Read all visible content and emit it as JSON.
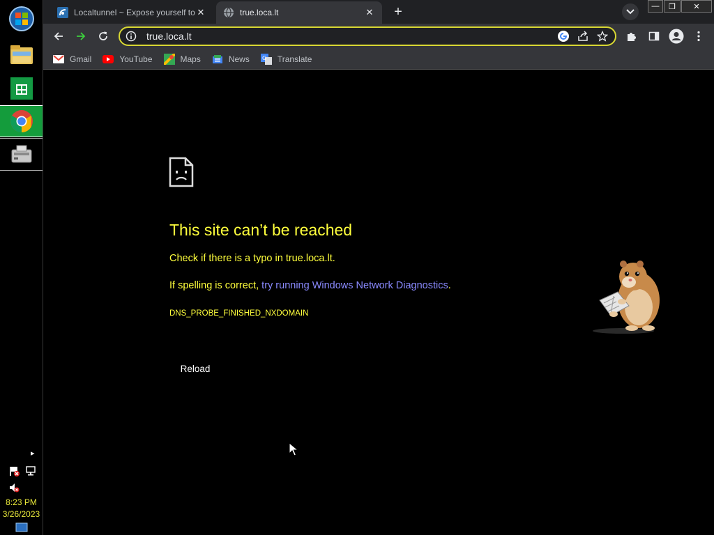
{
  "taskbar": {
    "apps": [
      {
        "name": "start-orb"
      },
      {
        "name": "file-explorer-icon"
      },
      {
        "name": "store-icon"
      },
      {
        "name": "chrome-icon",
        "active": true
      },
      {
        "name": "network-drive-icon"
      }
    ],
    "tray": {
      "time": "8:23 PM",
      "date": "3/26/2023",
      "expand_arrow": "▸"
    }
  },
  "browser": {
    "tabs": [
      {
        "title": "Localtunnel ~ Expose yourself to",
        "active": false,
        "close": "✕"
      },
      {
        "title": "true.loca.lt",
        "active": true,
        "close": "✕"
      }
    ],
    "new_tab": "+",
    "window_controls": {
      "minimize": "—",
      "restore": "❐",
      "close": "✕"
    },
    "address": "true.loca.lt",
    "bookmarks": [
      {
        "label": "Gmail",
        "icon": "gmail-icon"
      },
      {
        "label": "YouTube",
        "icon": "youtube-icon"
      },
      {
        "label": "Maps",
        "icon": "maps-icon"
      },
      {
        "label": "News",
        "icon": "news-icon"
      },
      {
        "label": "Translate",
        "icon": "translate-icon"
      }
    ]
  },
  "error_page": {
    "title": "This site can’t be reached",
    "line1": "Check if there is a typo in true.loca.lt.",
    "line2_prefix": "If spelling is correct, ",
    "line2_link": "try running Windows Network Diagnostics",
    "line2_suffix": ".",
    "code": "DNS_PROBE_FINISHED_NXDOMAIN",
    "reload_label": "Reload"
  },
  "colors": {
    "accent_text": "#ffff3c",
    "link": "#8a8aff",
    "omnibox_border": "#d8d833",
    "taskbar_active": "#149c3c"
  }
}
